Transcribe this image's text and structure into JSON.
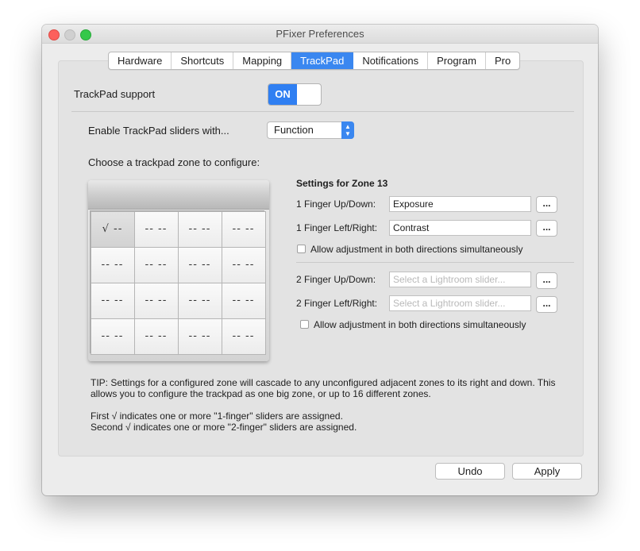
{
  "window": {
    "title": "PFixer Preferences"
  },
  "tabs": [
    {
      "label": "Hardware"
    },
    {
      "label": "Shortcuts"
    },
    {
      "label": "Mapping"
    },
    {
      "label": "TrackPad",
      "active": true
    },
    {
      "label": "Notifications"
    },
    {
      "label": "Program"
    },
    {
      "label": "Pro"
    }
  ],
  "trackpad_support": {
    "label": "TrackPad support",
    "toggle_state": "ON"
  },
  "sliders_enable": {
    "label": "Enable TrackPad sliders with...",
    "selected": "Function"
  },
  "zone_chooser": {
    "label": "Choose a trackpad zone to configure:",
    "cells": [
      "√ --",
      "-- --",
      "-- --",
      "-- --",
      "-- --",
      "-- --",
      "-- --",
      "-- --",
      "-- --",
      "-- --",
      "-- --",
      "-- --",
      "-- --",
      "-- --",
      "-- --",
      "-- --"
    ],
    "selected_index": 0
  },
  "settings": {
    "heading": "Settings for Zone 13",
    "one_finger": {
      "up_down_label": "1 Finger Up/Down:",
      "up_down_value": "Exposure",
      "left_right_label": "1 Finger Left/Right:",
      "left_right_value": "Contrast",
      "both_label": "Allow adjustment in both directions simultaneously"
    },
    "two_finger": {
      "up_down_label": "2 Finger Up/Down:",
      "up_down_placeholder": "Select a Lightroom slider...",
      "left_right_label": "2 Finger Left/Right:",
      "left_right_placeholder": "Select a Lightroom slider...",
      "both_label": "Allow adjustment in both directions simultaneously"
    },
    "more_button": "..."
  },
  "tips": {
    "line1": "TIP: Settings for a configured zone will cascade to any unconfigured adjacent zones to its right and down. This",
    "line2": "allows you to configure the trackpad as one big zone, or up to 16 different zones.",
    "line3": "First √ indicates one or more \"1-finger\" sliders are assigned.",
    "line4": "Second √ indicates one or more \"2-finger\" sliders are assigned."
  },
  "buttons": {
    "undo": "Undo",
    "apply": "Apply"
  },
  "colors": {
    "accent": "#3a87f0",
    "toggle_on": "#2f7ff2"
  }
}
